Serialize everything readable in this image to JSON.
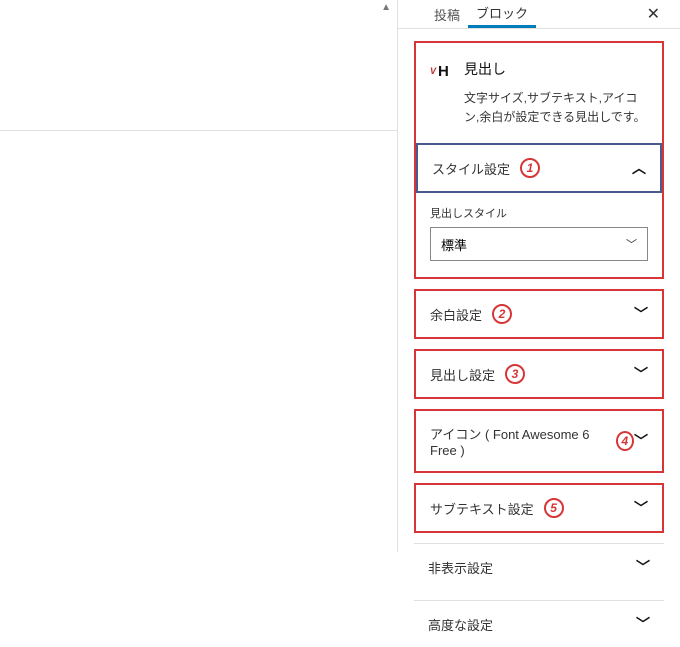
{
  "tabs": {
    "post": "投稿",
    "block": "ブロック"
  },
  "block_header": {
    "title": "見出し",
    "description": "文字サイズ,サブテキスト,アイコン,余白が設定できる見出しです。"
  },
  "sections": {
    "style": {
      "label": "スタイル設定",
      "badge": "1"
    },
    "style_field_label": "見出しスタイル",
    "style_select_value": "標準",
    "margin": {
      "label": "余白設定",
      "badge": "2"
    },
    "heading": {
      "label": "見出し設定",
      "badge": "3"
    },
    "icon": {
      "label": "アイコン ( Font Awesome 6 Free )",
      "badge": "4"
    },
    "subtext": {
      "label": "サブテキスト設定",
      "badge": "5"
    },
    "hide": {
      "label": "非表示設定"
    },
    "advanced": {
      "label": "高度な設定"
    }
  }
}
